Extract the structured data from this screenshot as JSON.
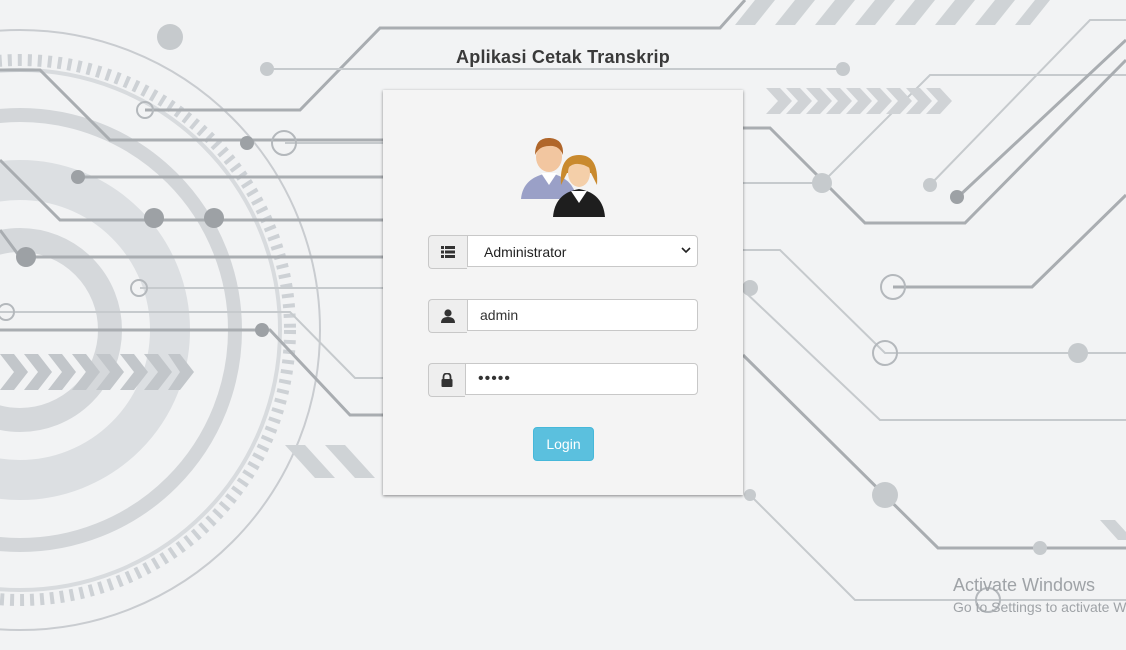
{
  "app": {
    "title": "Aplikasi Cetak Transkrip"
  },
  "login": {
    "role_select": {
      "selected": "Administrator",
      "options": [
        "Administrator"
      ]
    },
    "username": {
      "value": "admin"
    },
    "password": {
      "value": "admin"
    },
    "button_label": "Login"
  },
  "watermark": {
    "line1": "Activate Windows",
    "line2": "Go to Settings to activate W"
  },
  "icons": {
    "avatar": "users-icon",
    "role": "list-icon",
    "user": "user-icon",
    "password": "lock-icon"
  },
  "colors": {
    "button": "#5bc0de",
    "background": "#f2f3f4",
    "circuit": "#c4c8cc"
  }
}
